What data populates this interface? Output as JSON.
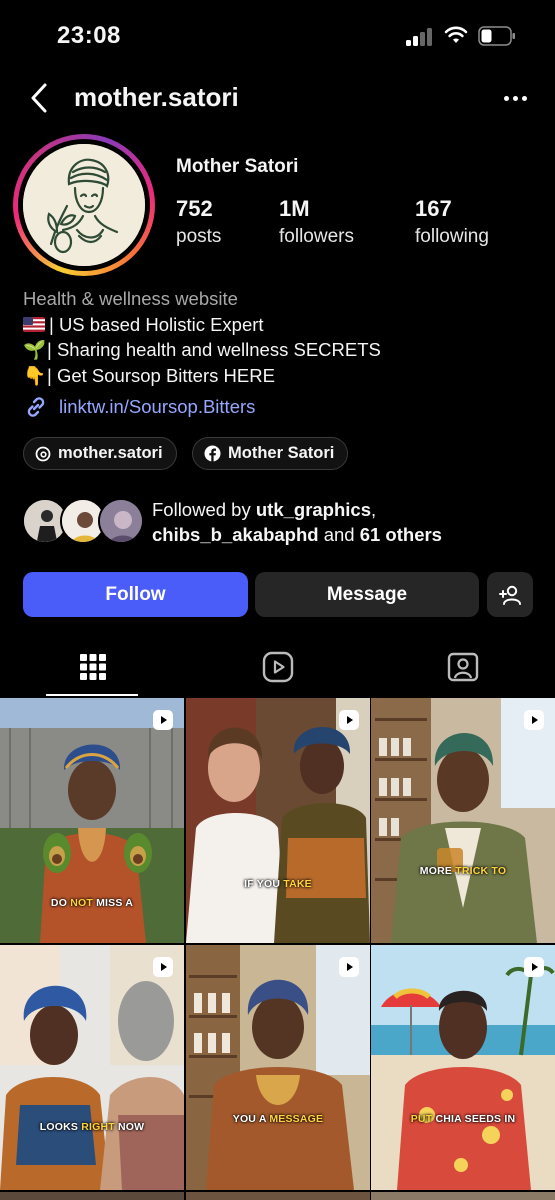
{
  "status_bar": {
    "time": "23:08"
  },
  "header": {
    "handle": "mother.satori"
  },
  "profile": {
    "display_name": "Mother Satori",
    "stats": [
      {
        "value": "752",
        "label": "posts"
      },
      {
        "value": "1M",
        "label": "followers"
      },
      {
        "value": "167",
        "label": "following"
      }
    ],
    "category": "Health & wellness website",
    "bio_lines": [
      {
        "emoji": "us-flag",
        "text": "| US based Holistic Expert"
      },
      {
        "emoji": "🌱",
        "text": "| Sharing health and wellness SECRETS"
      },
      {
        "emoji": "👇",
        "text": "| Get Soursop Bitters HERE"
      }
    ],
    "link": "linktw.in/Soursop.Bitters",
    "threads_label": "mother.satori",
    "facebook_label": "Mother Satori",
    "followed_by": {
      "prefix": "Followed by ",
      "user1": "utk_graphics",
      "sep": ",",
      "user2": "chibs_b_akabaphd",
      "mid": " and ",
      "others": "61 others"
    }
  },
  "actions": {
    "follow": "Follow",
    "message": "Message"
  },
  "tabs": [
    "grid-icon",
    "reels-icon",
    "tagged-icon"
  ],
  "posts": [
    {
      "caption_pre": "DO ",
      "caption_hl": "NOT",
      "caption_post": " MISS A"
    },
    {
      "caption_pre": "IF YOU ",
      "caption_hl": "TAKE",
      "caption_post": ""
    },
    {
      "caption_pre": "MORE ",
      "caption_hl": "TRICK TO",
      "caption_post": ""
    },
    {
      "caption_pre": "LOOKS ",
      "caption_hl": "RIGHT",
      "caption_post": " NOW"
    },
    {
      "caption_pre": "YOU A ",
      "caption_hl": "MESSAGE",
      "caption_post": ""
    },
    {
      "caption_pre": "",
      "caption_hl": "PUT",
      "caption_post": " CHIA SEEDS IN"
    }
  ],
  "colors": {
    "follow_button": "#4a5df9",
    "link": "#96a7ff",
    "background": "#000000"
  }
}
